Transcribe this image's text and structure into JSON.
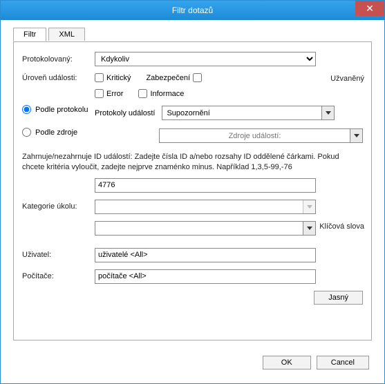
{
  "window": {
    "title": "Filtr dotazů"
  },
  "tabs": {
    "filter": "Filtr",
    "xml": "XML"
  },
  "labels": {
    "logged": "Protokolovaný:",
    "eventLevel": "Úroveň události:",
    "byLog": "Podle protokolu",
    "bySource": "Podle zdroje",
    "eventLogs": "Protokoly událostí",
    "eventSources": "Zdroje událostí:",
    "taskCategory": "Kategorie úkolu:",
    "user": "Uživatel:",
    "computers": "Počítače:",
    "userSuffix": "Užvaněný",
    "keywords": "Klíčová slova"
  },
  "levels": {
    "critical": "Kritický",
    "security": "Zabezpečení",
    "error": "Error",
    "information": "Informace"
  },
  "dropdowns": {
    "logged_value": "Kdykoliv",
    "eventLogs_value": "Supozornění",
    "eventSources_value": "",
    "taskCategory_value": "",
    "keywords_value": ""
  },
  "helpText": "Zahrnuje/nezahrnuje ID událostí: Zadejte čísla ID a/nebo rozsahy ID oddělené čárkami. Pokud chcete kritéria vyloučit, zadejte nejprve znaménko minus. Například 1,3,5-99,-76",
  "inputs": {
    "eventIds": "4776",
    "user": "uživatelé <All>",
    "computers": "počítače <All>"
  },
  "buttons": {
    "clear": "Jasný",
    "ok": "OK",
    "cancel": "Cancel"
  }
}
